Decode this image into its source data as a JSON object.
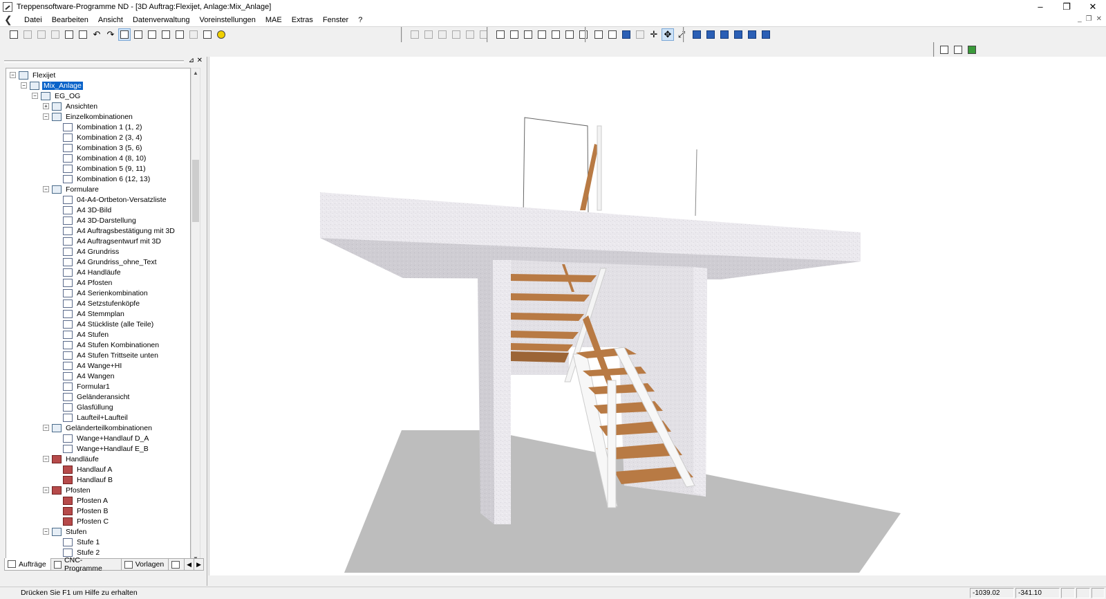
{
  "window": {
    "title": "Treppensoftware-Programme ND  - [3D Auftrag:Flexijet, Anlage:Mix_Anlage]",
    "controls": [
      "–",
      "❐",
      "✕"
    ]
  },
  "menu": [
    "Datei",
    "Bearbeiten",
    "Ansicht",
    "Datenverwaltung",
    "Voreinstellungen",
    "MAE",
    "Extras",
    "Fenster",
    "?"
  ],
  "tree": {
    "nodes": [
      {
        "label": "Flexijet",
        "level": 0,
        "exp": "−",
        "icon": "document-icon"
      },
      {
        "label": "Mix_Anlage",
        "level": 1,
        "exp": "−",
        "icon": "stair-system-icon",
        "selected": true
      },
      {
        "label": "EG_OG",
        "level": 2,
        "exp": "−",
        "icon": "floor-icon"
      },
      {
        "label": "Ansichten",
        "level": 3,
        "exp": "+",
        "icon": "views-icon"
      },
      {
        "label": "Einzelkombinationen",
        "level": 3,
        "exp": "−",
        "icon": "combination-icon"
      },
      {
        "label": "Kombination  1 (1, 2)",
        "level": 4,
        "icon": "combination-item-icon"
      },
      {
        "label": "Kombination  2 (3, 4)",
        "level": 4,
        "icon": "combination-item-icon"
      },
      {
        "label": "Kombination  3 (5, 6)",
        "level": 4,
        "icon": "combination-item-icon"
      },
      {
        "label": "Kombination  4 (8, 10)",
        "level": 4,
        "icon": "combination-item-icon"
      },
      {
        "label": "Kombination  5 (9, 11)",
        "level": 4,
        "icon": "combination-item-icon"
      },
      {
        "label": "Kombination  6 (12, 13)",
        "level": 4,
        "icon": "combination-item-icon"
      },
      {
        "label": "Formulare",
        "level": 3,
        "exp": "−",
        "icon": "forms-icon"
      },
      {
        "label": "04-A4-Ortbeton-Versatzliste",
        "level": 4,
        "icon": "form-icon"
      },
      {
        "label": "A4 3D-Bild",
        "level": 4,
        "icon": "form-icon"
      },
      {
        "label": "A4 3D-Darstellung",
        "level": 4,
        "icon": "form-icon"
      },
      {
        "label": "A4 Auftragsbestätigung mit 3D",
        "level": 4,
        "icon": "form-icon"
      },
      {
        "label": "A4 Auftragsentwurf mit 3D",
        "level": 4,
        "icon": "form-icon"
      },
      {
        "label": "A4 Grundriss",
        "level": 4,
        "icon": "form-icon"
      },
      {
        "label": "A4 Grundriss_ohne_Text",
        "level": 4,
        "icon": "form-icon"
      },
      {
        "label": "A4 Handläufe",
        "level": 4,
        "icon": "form-icon"
      },
      {
        "label": "A4 Pfosten",
        "level": 4,
        "icon": "form-icon"
      },
      {
        "label": "A4 Serienkombination",
        "level": 4,
        "icon": "form-icon"
      },
      {
        "label": "A4 Setzstufenköpfe",
        "level": 4,
        "icon": "form-icon"
      },
      {
        "label": "A4 Stemmplan",
        "level": 4,
        "icon": "form-icon"
      },
      {
        "label": "A4 Stückliste (alle Teile)",
        "level": 4,
        "icon": "form-icon"
      },
      {
        "label": "A4 Stufen",
        "level": 4,
        "icon": "form-icon"
      },
      {
        "label": "A4 Stufen Kombinationen",
        "level": 4,
        "icon": "form-icon"
      },
      {
        "label": "A4 Stufen Trittseite unten",
        "level": 4,
        "icon": "form-icon"
      },
      {
        "label": "A4 Wange+HI",
        "level": 4,
        "icon": "form-icon"
      },
      {
        "label": "A4 Wangen",
        "level": 4,
        "icon": "form-icon"
      },
      {
        "label": "Formular1",
        "level": 4,
        "icon": "form-icon"
      },
      {
        "label": "Geländeransicht",
        "level": 4,
        "icon": "form-icon"
      },
      {
        "label": "Glasfüllung",
        "level": 4,
        "icon": "form-icon"
      },
      {
        "label": "Laufteil+Laufteil",
        "level": 4,
        "icon": "form-icon"
      },
      {
        "label": "Geländerteilkombinationen",
        "level": 3,
        "exp": "−",
        "icon": "railing-combination-icon"
      },
      {
        "label": "Wange+Handlauf D_A",
        "level": 4,
        "icon": "railing-item-icon"
      },
      {
        "label": "Wange+Handlauf E_B",
        "level": 4,
        "icon": "railing-item-icon"
      },
      {
        "label": "Handläufe",
        "level": 3,
        "exp": "−",
        "icon": "handrails-icon"
      },
      {
        "label": "Handlauf A",
        "level": 4,
        "icon": "handrail-icon"
      },
      {
        "label": "Handlauf B",
        "level": 4,
        "icon": "handrail-icon"
      },
      {
        "label": "Pfosten",
        "level": 3,
        "exp": "−",
        "icon": "posts-icon"
      },
      {
        "label": "Pfosten A",
        "level": 4,
        "icon": "post-icon"
      },
      {
        "label": "Pfosten B",
        "level": 4,
        "icon": "post-icon"
      },
      {
        "label": "Pfosten C",
        "level": 4,
        "icon": "post-icon"
      },
      {
        "label": "Stufen",
        "level": 3,
        "exp": "−",
        "icon": "steps-icon"
      },
      {
        "label": "Stufe  1",
        "level": 4,
        "icon": "step-icon"
      },
      {
        "label": "Stufe  2",
        "level": 4,
        "icon": "step-icon"
      }
    ]
  },
  "panel_tabs": [
    {
      "label": "Aufträge",
      "icon": "orders-icon"
    },
    {
      "label": "CNC-Programme",
      "icon": "cnc-icon"
    },
    {
      "label": "Vorlagen",
      "icon": "templates-icon"
    }
  ],
  "status": {
    "message": "Drücken Sie  F1  um Hilfe zu erhalten",
    "coord_x": "-1039.02",
    "coord_y": "-341.10"
  },
  "colors": {
    "selection": "#0a63c9",
    "wood": "#b87a44",
    "concrete": "#e8e6ea",
    "floor": "#bdbdbd"
  }
}
